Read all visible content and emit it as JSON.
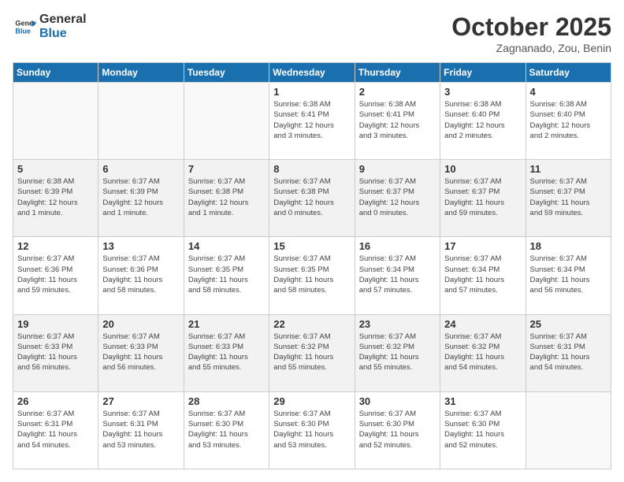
{
  "header": {
    "logo_line1": "General",
    "logo_line2": "Blue",
    "title": "October 2025",
    "subtitle": "Zagnanado, Zou, Benin"
  },
  "weekdays": [
    "Sunday",
    "Monday",
    "Tuesday",
    "Wednesday",
    "Thursday",
    "Friday",
    "Saturday"
  ],
  "weeks": [
    [
      {
        "num": "",
        "info": ""
      },
      {
        "num": "",
        "info": ""
      },
      {
        "num": "",
        "info": ""
      },
      {
        "num": "1",
        "info": "Sunrise: 6:38 AM\nSunset: 6:41 PM\nDaylight: 12 hours\nand 3 minutes."
      },
      {
        "num": "2",
        "info": "Sunrise: 6:38 AM\nSunset: 6:41 PM\nDaylight: 12 hours\nand 3 minutes."
      },
      {
        "num": "3",
        "info": "Sunrise: 6:38 AM\nSunset: 6:40 PM\nDaylight: 12 hours\nand 2 minutes."
      },
      {
        "num": "4",
        "info": "Sunrise: 6:38 AM\nSunset: 6:40 PM\nDaylight: 12 hours\nand 2 minutes."
      }
    ],
    [
      {
        "num": "5",
        "info": "Sunrise: 6:38 AM\nSunset: 6:39 PM\nDaylight: 12 hours\nand 1 minute."
      },
      {
        "num": "6",
        "info": "Sunrise: 6:37 AM\nSunset: 6:39 PM\nDaylight: 12 hours\nand 1 minute."
      },
      {
        "num": "7",
        "info": "Sunrise: 6:37 AM\nSunset: 6:38 PM\nDaylight: 12 hours\nand 1 minute."
      },
      {
        "num": "8",
        "info": "Sunrise: 6:37 AM\nSunset: 6:38 PM\nDaylight: 12 hours\nand 0 minutes."
      },
      {
        "num": "9",
        "info": "Sunrise: 6:37 AM\nSunset: 6:37 PM\nDaylight: 12 hours\nand 0 minutes."
      },
      {
        "num": "10",
        "info": "Sunrise: 6:37 AM\nSunset: 6:37 PM\nDaylight: 11 hours\nand 59 minutes."
      },
      {
        "num": "11",
        "info": "Sunrise: 6:37 AM\nSunset: 6:37 PM\nDaylight: 11 hours\nand 59 minutes."
      }
    ],
    [
      {
        "num": "12",
        "info": "Sunrise: 6:37 AM\nSunset: 6:36 PM\nDaylight: 11 hours\nand 59 minutes."
      },
      {
        "num": "13",
        "info": "Sunrise: 6:37 AM\nSunset: 6:36 PM\nDaylight: 11 hours\nand 58 minutes."
      },
      {
        "num": "14",
        "info": "Sunrise: 6:37 AM\nSunset: 6:35 PM\nDaylight: 11 hours\nand 58 minutes."
      },
      {
        "num": "15",
        "info": "Sunrise: 6:37 AM\nSunset: 6:35 PM\nDaylight: 11 hours\nand 58 minutes."
      },
      {
        "num": "16",
        "info": "Sunrise: 6:37 AM\nSunset: 6:34 PM\nDaylight: 11 hours\nand 57 minutes."
      },
      {
        "num": "17",
        "info": "Sunrise: 6:37 AM\nSunset: 6:34 PM\nDaylight: 11 hours\nand 57 minutes."
      },
      {
        "num": "18",
        "info": "Sunrise: 6:37 AM\nSunset: 6:34 PM\nDaylight: 11 hours\nand 56 minutes."
      }
    ],
    [
      {
        "num": "19",
        "info": "Sunrise: 6:37 AM\nSunset: 6:33 PM\nDaylight: 11 hours\nand 56 minutes."
      },
      {
        "num": "20",
        "info": "Sunrise: 6:37 AM\nSunset: 6:33 PM\nDaylight: 11 hours\nand 56 minutes."
      },
      {
        "num": "21",
        "info": "Sunrise: 6:37 AM\nSunset: 6:33 PM\nDaylight: 11 hours\nand 55 minutes."
      },
      {
        "num": "22",
        "info": "Sunrise: 6:37 AM\nSunset: 6:32 PM\nDaylight: 11 hours\nand 55 minutes."
      },
      {
        "num": "23",
        "info": "Sunrise: 6:37 AM\nSunset: 6:32 PM\nDaylight: 11 hours\nand 55 minutes."
      },
      {
        "num": "24",
        "info": "Sunrise: 6:37 AM\nSunset: 6:32 PM\nDaylight: 11 hours\nand 54 minutes."
      },
      {
        "num": "25",
        "info": "Sunrise: 6:37 AM\nSunset: 6:31 PM\nDaylight: 11 hours\nand 54 minutes."
      }
    ],
    [
      {
        "num": "26",
        "info": "Sunrise: 6:37 AM\nSunset: 6:31 PM\nDaylight: 11 hours\nand 54 minutes."
      },
      {
        "num": "27",
        "info": "Sunrise: 6:37 AM\nSunset: 6:31 PM\nDaylight: 11 hours\nand 53 minutes."
      },
      {
        "num": "28",
        "info": "Sunrise: 6:37 AM\nSunset: 6:30 PM\nDaylight: 11 hours\nand 53 minutes."
      },
      {
        "num": "29",
        "info": "Sunrise: 6:37 AM\nSunset: 6:30 PM\nDaylight: 11 hours\nand 53 minutes."
      },
      {
        "num": "30",
        "info": "Sunrise: 6:37 AM\nSunset: 6:30 PM\nDaylight: 11 hours\nand 52 minutes."
      },
      {
        "num": "31",
        "info": "Sunrise: 6:37 AM\nSunset: 6:30 PM\nDaylight: 11 hours\nand 52 minutes."
      },
      {
        "num": "",
        "info": ""
      }
    ]
  ]
}
